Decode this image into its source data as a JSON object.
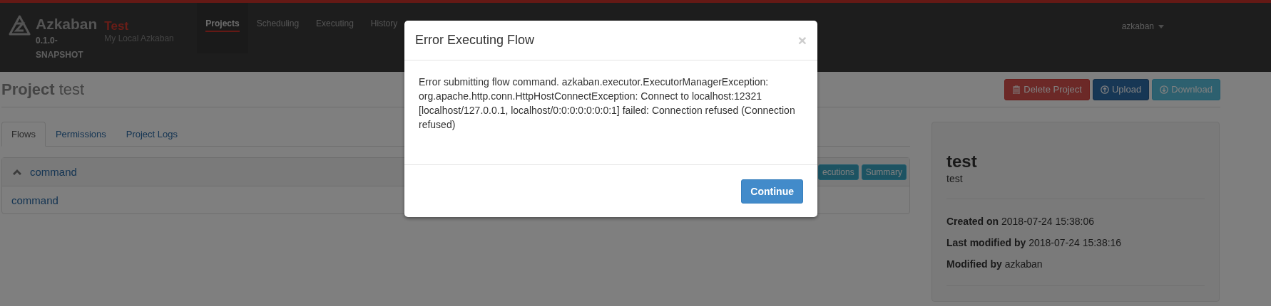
{
  "header": {
    "logo": "Azkaban",
    "version": "0.1.0-\nSNAPSHOT",
    "brand": "Test",
    "subtitle": "My Local Azkaban",
    "nav": [
      {
        "label": "Projects",
        "selected": true
      },
      {
        "label": "Scheduling",
        "selected": false
      },
      {
        "label": "Executing",
        "selected": false
      },
      {
        "label": "History",
        "selected": false
      }
    ],
    "user": "azkaban"
  },
  "page": {
    "title_prefix": "Project",
    "title": "test",
    "actions": [
      {
        "kind": "delete",
        "label": "Delete Project"
      },
      {
        "kind": "upload",
        "label": "Upload"
      },
      {
        "kind": "download",
        "label": "Download"
      }
    ]
  },
  "tabs": [
    {
      "label": "Flows",
      "selected": true
    },
    {
      "label": "Permissions",
      "selected": false
    },
    {
      "label": "Project Logs",
      "selected": false
    }
  ],
  "flow": {
    "name": "command",
    "expanded": true,
    "buttons": [
      "ecutions",
      "Summary"
    ],
    "jobs": [
      "command"
    ]
  },
  "card": {
    "name": "test",
    "description": "test",
    "details": [
      {
        "label": "Created on",
        "value": "2018-07-24 15:38:06"
      },
      {
        "label": "Last modified by",
        "value": "2018-07-24 15:38:16"
      },
      {
        "label": "Modified by",
        "value": "azkaban"
      }
    ]
  },
  "modal": {
    "title": "Error Executing Flow",
    "close": "×",
    "message": "Error submitting flow command. azkaban.executor.ExecutorManagerException: org.apache.http.conn.HttpHostConnectException: Connect to localhost:12321 [localhost/127.0.0.1, localhost/0:0:0:0:0:0:0:1] failed: Connection refused (Connection refused)",
    "button": "Continue"
  }
}
